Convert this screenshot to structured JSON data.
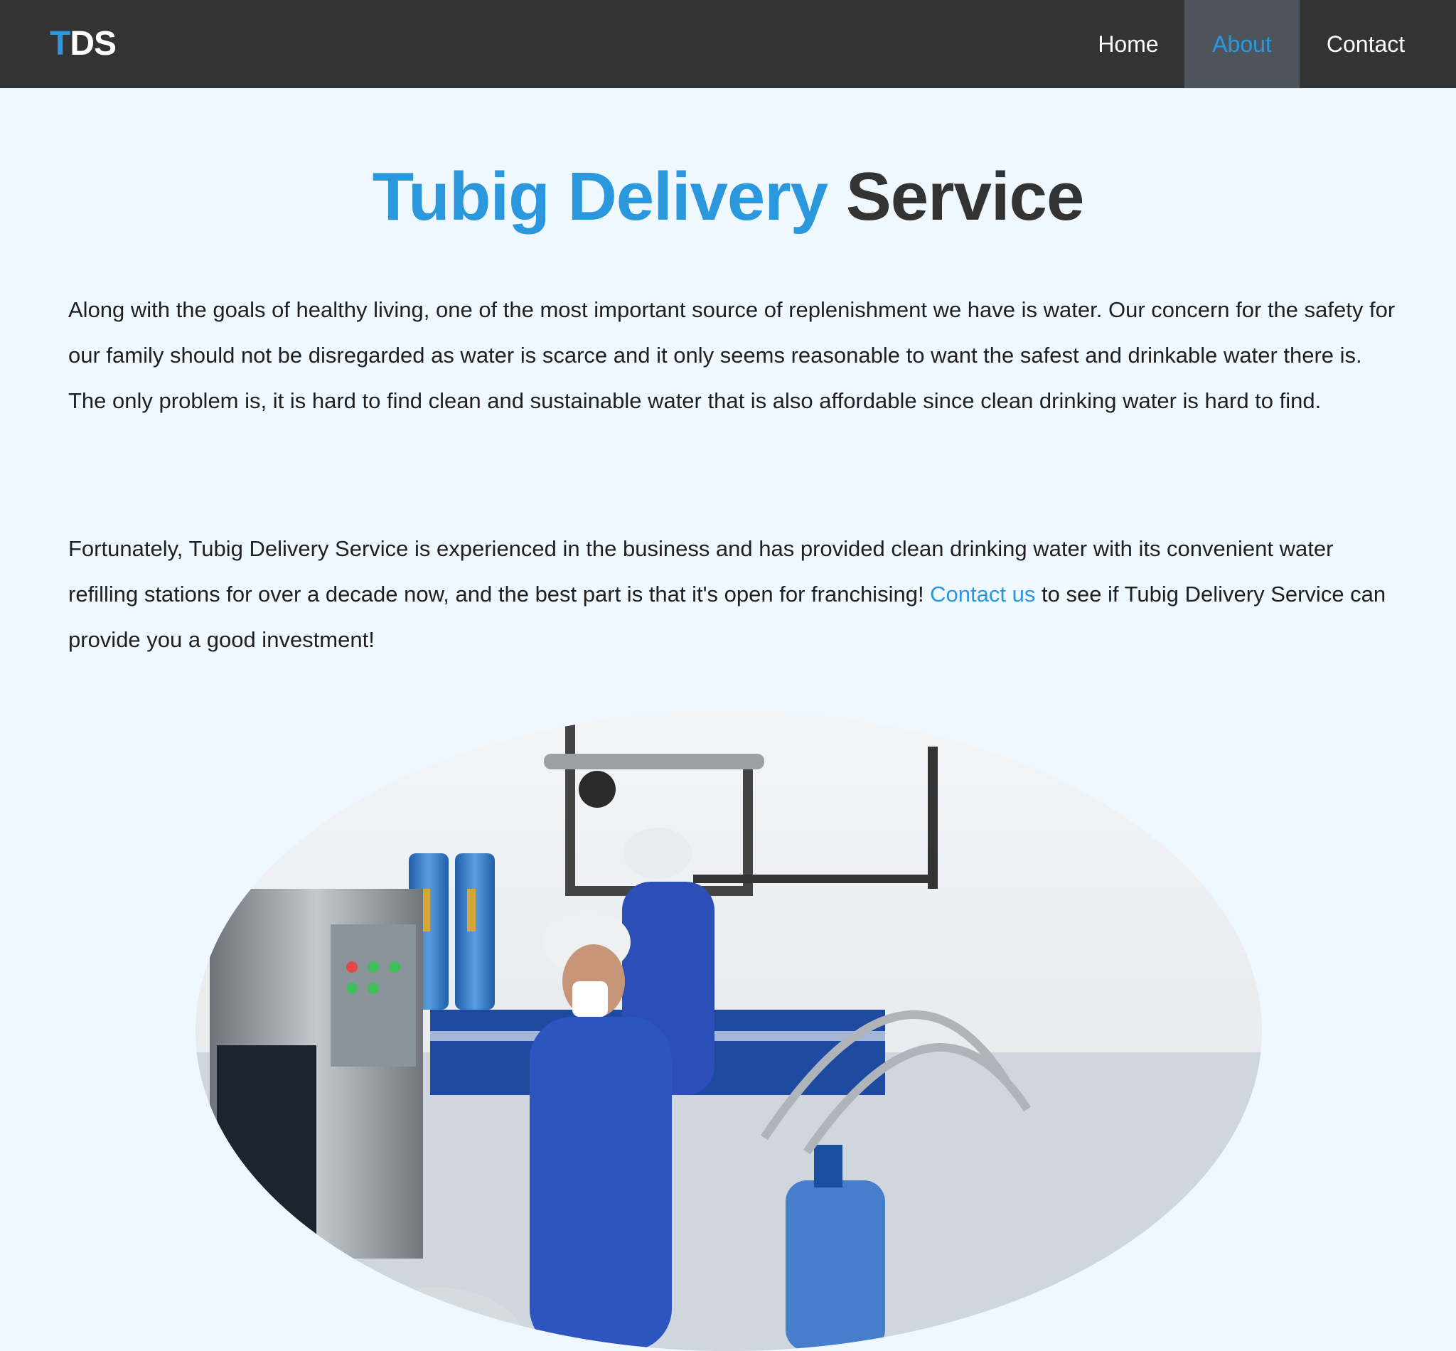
{
  "navbar": {
    "logo_accent": "T",
    "logo_rest": "DS",
    "items": [
      {
        "label": "Home"
      },
      {
        "label": "About"
      },
      {
        "label": "Contact"
      }
    ],
    "active_item": "About"
  },
  "main": {
    "title_accent": "Tubig Delivery",
    "title_rest": " Service",
    "paragraph1": "Along with the goals of healthy living, one of the most important source of replenishment we have is water. Our concern for the safety for our family should not be disregarded as water is scarce and it only seems reasonable to want the safest and drinkable water there is. The only problem is, it is hard to find clean and sustainable water that is also affordable since clean drinking water is hard to find.",
    "paragraph2_before": "Fortunately, Tubig Delivery Service is experienced in the business and has provided clean drinking water with its convenient water refilling stations for over a decade now, and the best part is that it's open for franchising! ",
    "paragraph2_link": "Contact us",
    "paragraph2_after": " to see if Tubig Delivery Service can provide you a good investment!"
  },
  "colors": {
    "accent": "#2b98de",
    "navbar_bg": "#333333",
    "active_nav_bg": "#4e545c",
    "page_bg": "#eff7ff",
    "text": "#1f1f1f"
  }
}
